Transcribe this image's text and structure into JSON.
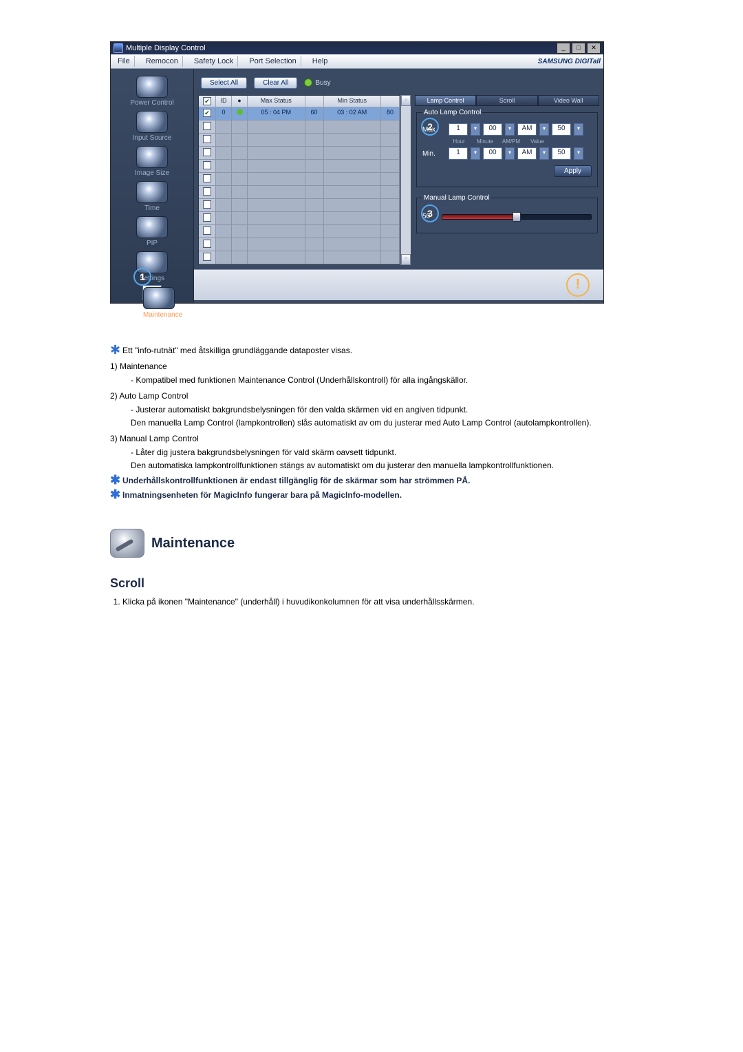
{
  "app": {
    "title": "Multiple Display Control",
    "menu": [
      "File",
      "Remocon",
      "Safety Lock",
      "Port Selection",
      "Help"
    ],
    "brand": "SAMSUNG DIGITall",
    "winbtns": {
      "min": "_",
      "max": "□",
      "close": "✕"
    }
  },
  "sidebar": {
    "items": [
      {
        "label": "Power Control"
      },
      {
        "label": "Input Source"
      },
      {
        "label": "Image Size"
      },
      {
        "label": "Time"
      },
      {
        "label": "PIP"
      },
      {
        "label": "Settings"
      },
      {
        "label": "Maintenance",
        "selected": true
      }
    ]
  },
  "callouts": {
    "one": "1",
    "two": "2",
    "three": "3"
  },
  "toolbar": {
    "select_all": "Select All",
    "clear_all": "Clear All",
    "busy": "Busy"
  },
  "grid": {
    "headers": {
      "chk": "",
      "id": "ID",
      "status": "",
      "max": "Max Status",
      "col60": "",
      "min": "Min Status",
      "col80": ""
    },
    "row0": {
      "id": "0",
      "max": "05 : 04 PM",
      "v60": "60",
      "min": "03 : 02 AM",
      "v80": "80"
    }
  },
  "tabs": {
    "lamp": "Lamp Control",
    "scroll": "Scroll",
    "video": "Video Wall"
  },
  "auto_lamp": {
    "legend": "Auto Lamp Control",
    "sub": {
      "hour": "Hour",
      "minute": "Minute",
      "ampm": "AM/PM",
      "value": "Value"
    },
    "max": {
      "label": "Max.",
      "hour": "1",
      "minute": "00",
      "ampm": "AM",
      "value": "50"
    },
    "min": {
      "label": "Min.",
      "hour": "1",
      "minute": "00",
      "ampm": "AM",
      "value": "50"
    },
    "apply": "Apply"
  },
  "manual_lamp": {
    "legend": "Manual Lamp Control",
    "value": "50"
  },
  "desc": {
    "intro": "Ett \"info-rutnät\" med åtskilliga grundläggande dataposter visas.",
    "items": [
      {
        "num": "1)",
        "title": "Maintenance",
        "lines": [
          "- Kompatibel med funktionen Maintenance Control (Underhållskontroll) för alla ingångskällor."
        ]
      },
      {
        "num": "2)",
        "title": "Auto Lamp Control",
        "lines": [
          "- Justerar automatiskt bakgrundsbelysningen för den valda skärmen vid en angiven tidpunkt.",
          "Den manuella Lamp Control (lampkontrollen) slås automatiskt av om du justerar med Auto Lamp Control (autolampkontrollen)."
        ]
      },
      {
        "num": "3)",
        "title": "Manual Lamp Control",
        "lines": [
          "- Låter dig justera bakgrundsbelysningen för vald skärm oavsett tidpunkt.",
          "Den automatiska lampkontrollfunktionen stängs av automatiskt om du justerar den manuella lampkontrollfunktionen."
        ]
      }
    ],
    "note1": "Underhållskontrollfunktionen är endast tillgänglig för de skärmar som har strömmen PÅ.",
    "note2": "Inmatningsenheten för MagicInfo fungerar bara på MagicInfo-modellen.",
    "h_maint": "Maintenance",
    "h_scroll": "Scroll",
    "scroll_step": "Klicka på ikonen \"Maintenance\" (underhåll) i huvudikonkolumnen för att visa underhållsskärmen."
  }
}
